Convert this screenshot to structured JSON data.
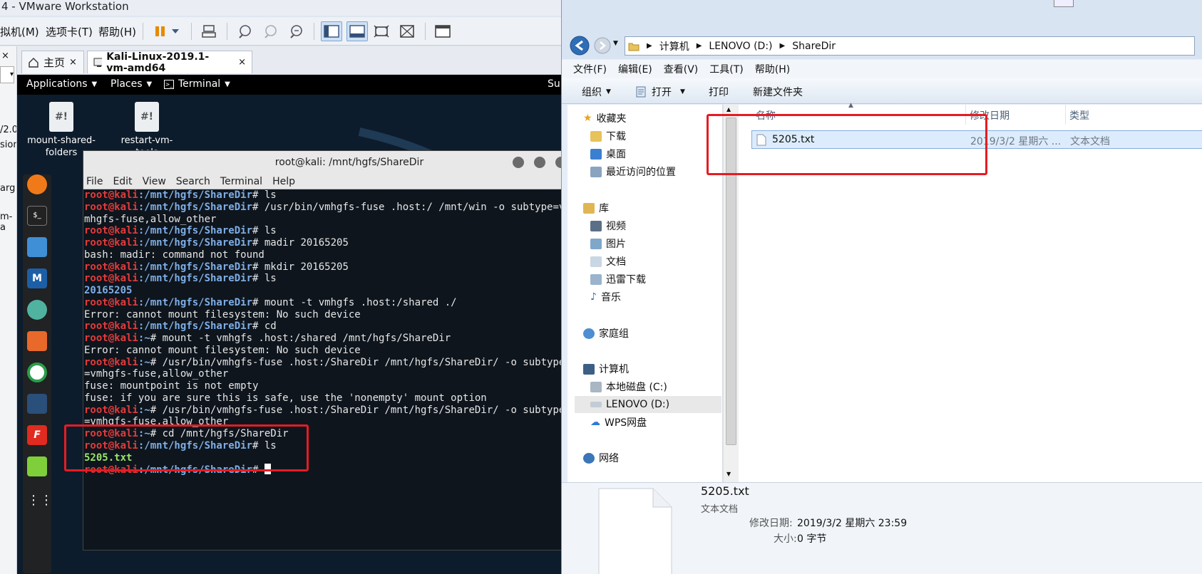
{
  "vmware": {
    "title": "4 - VMware Workstation",
    "menus": [
      "拟机(M)",
      "选项卡(T)",
      "帮助(H)"
    ],
    "left_strip_texts": [
      "/2.0",
      "sion",
      "arg",
      "m-a"
    ],
    "tabs": [
      "主页",
      "Kali-Linux-2019.1-vm-amd64"
    ]
  },
  "kali": {
    "topbar": {
      "applications": "Applications",
      "places": "Places",
      "terminal": "Terminal",
      "right": "Su"
    },
    "desktop_icons": [
      {
        "label": "mount-shared-folders",
        "glyph": "#!"
      },
      {
        "label": "restart-vm-tools",
        "glyph": "#!"
      }
    ],
    "dock_icons": [
      "firefox-icon",
      "terminal-icon",
      "files-icon",
      "metasploit-icon",
      "armitage-icon",
      "burpsuite-icon",
      "maltego-icon",
      "beef-icon",
      "faraday-icon",
      "leafpad-icon",
      "show-apps-icon"
    ]
  },
  "terminal": {
    "title": "root@kali: /mnt/hgfs/ShareDir",
    "menu": [
      "File",
      "Edit",
      "View",
      "Search",
      "Terminal",
      "Help"
    ],
    "lines": [
      {
        "user": "root@kali",
        "path": ":/mnt/hgfs/ShareDir",
        "cmd": "# ls"
      },
      {
        "user": "root@kali",
        "path": ":/mnt/hgfs/ShareDir",
        "cmd": "# /usr/bin/vmhgfs-fuse .host:/ /mnt/win -o subtype=v"
      },
      {
        "text": "mhgfs-fuse,allow_other"
      },
      {
        "user": "root@kali",
        "path": ":/mnt/hgfs/ShareDir",
        "cmd": "# ls"
      },
      {
        "user": "root@kali",
        "path": ":/mnt/hgfs/ShareDir",
        "cmd": "# madir 20165205"
      },
      {
        "text": "bash: madir: command not found"
      },
      {
        "user": "root@kali",
        "path": ":/mnt/hgfs/ShareDir",
        "cmd": "# mkdir 20165205"
      },
      {
        "user": "root@kali",
        "path": ":/mnt/hgfs/ShareDir",
        "cmd": "# ls"
      },
      {
        "dir": "20165205"
      },
      {
        "user": "root@kali",
        "path": ":/mnt/hgfs/ShareDir",
        "cmd": "# mount -t vmhgfs .host:/shared ./"
      },
      {
        "text": "Error: cannot mount filesystem: No such device"
      },
      {
        "user": "root@kali",
        "path": ":/mnt/hgfs/ShareDir",
        "cmd": "# cd"
      },
      {
        "user": "root@kali",
        "path": ":~",
        "cmd": "# mount -t vmhgfs .host:/shared /mnt/hgfs/ShareDir"
      },
      {
        "text": "Error: cannot mount filesystem: No such device"
      },
      {
        "user": "root@kali",
        "path": ":~",
        "cmd": "# /usr/bin/vmhgfs-fuse .host:/ShareDir /mnt/hgfs/ShareDir/ -o subtype"
      },
      {
        "text": "=vmhgfs-fuse,allow_other"
      },
      {
        "text": "fuse: mountpoint is not empty"
      },
      {
        "text": "fuse: if you are sure this is safe, use the 'nonempty' mount option"
      },
      {
        "user": "root@kali",
        "path": ":~",
        "cmd": "# /usr/bin/vmhgfs-fuse .host:/ShareDir /mnt/hgfs/ShareDir/ -o subtype"
      },
      {
        "text": "=vmhgfs-fuse,allow_other"
      },
      {
        "user": "root@kali",
        "path": ":~",
        "cmd": "# cd /mnt/hgfs/ShareDir"
      },
      {
        "user": "root@kali",
        "path": ":/mnt/hgfs/ShareDir",
        "cmd": "# ls"
      },
      {
        "file": "5205.txt"
      },
      {
        "user": "root@kali",
        "path": ":/mnt/hgfs/ShareDir",
        "cmd": "# ",
        "cursor": true
      }
    ]
  },
  "explorer": {
    "breadcrumb": [
      "计算机",
      "LENOVO (D:)",
      "ShareDir"
    ],
    "menu": [
      "文件(F)",
      "编辑(E)",
      "查看(V)",
      "工具(T)",
      "帮助(H)"
    ],
    "toolbar": {
      "organize": "组织",
      "open": "打开",
      "print": "打印",
      "new_folder": "新建文件夹"
    },
    "nav": {
      "favorites": "收藏夹",
      "downloads": "下载",
      "desktop": "桌面",
      "recent": "最近访问的位置",
      "libraries": "库",
      "videos": "视频",
      "pictures": "图片",
      "documents": "文档",
      "thunder": "迅雷下载",
      "music": "音乐",
      "homegroup": "家庭组",
      "computer": "计算机",
      "local_disk": "本地磁盘 (C:)",
      "lenovo": "LENOVO (D:)",
      "wps": "WPS网盘",
      "network": "网络"
    },
    "columns": {
      "name": "名称",
      "date": "修改日期",
      "type": "类型"
    },
    "file": {
      "name": "5205.txt",
      "date": "2019/3/2 星期六 ...",
      "type": "文本文档"
    },
    "details": {
      "name": "5205.txt",
      "type": "文本文档",
      "modified_label": "修改日期:",
      "modified_value": "2019/3/2 星期六 23:59",
      "size_label": "大小:",
      "size_value": "0 字节"
    }
  }
}
